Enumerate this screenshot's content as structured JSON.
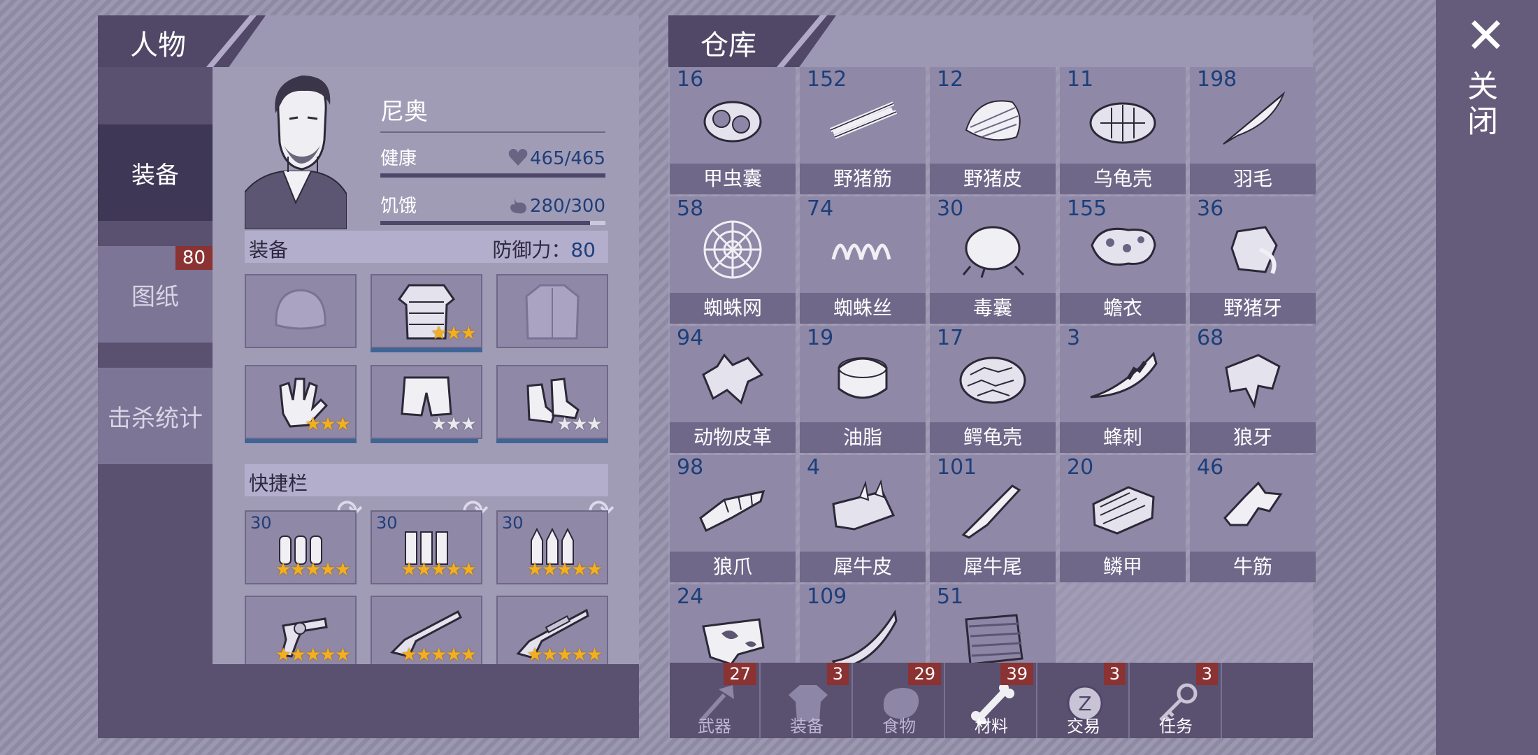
{
  "character_panel": {
    "title": "人物",
    "side_tabs": [
      {
        "label": "装备",
        "active": true
      },
      {
        "label": "图纸",
        "badge": "80"
      },
      {
        "label": "击杀统计"
      }
    ],
    "name": "尼奥",
    "health": {
      "label": "健康",
      "value": "465/465",
      "fraction": 1.0
    },
    "hunger": {
      "label": "饥饿",
      "value": "280/300",
      "fraction": 0.933
    },
    "equipment_header": {
      "label": "装备",
      "defense_label": "防御力：",
      "defense_value": "80"
    },
    "equipment_slots": [
      {
        "icon": "helmet-icon",
        "stars": 0,
        "durability": 0
      },
      {
        "icon": "armor-vest-icon",
        "stars": 3,
        "durability": 1.0
      },
      {
        "icon": "jacket-icon",
        "stars": 0,
        "durability": 0
      },
      {
        "icon": "gloves-icon",
        "stars": 3,
        "durability": 1.0
      },
      {
        "icon": "pants-icon",
        "stars": 3,
        "gold_stars": 1,
        "durability": 0.97
      },
      {
        "icon": "boots-icon",
        "stars": 3,
        "gold_stars": 0,
        "durability": 1.0
      }
    ],
    "quickbar_header": "快捷栏",
    "quickbar_ammo": [
      {
        "count": "30",
        "icon": "ammo-pistol-icon"
      },
      {
        "count": "30",
        "icon": "ammo-shotgun-icon"
      },
      {
        "count": "30",
        "icon": "ammo-rifle-icon"
      }
    ],
    "quickbar_weapons": [
      {
        "icon": "revolver-icon",
        "durability": 1.0
      },
      {
        "icon": "shotgun-icon",
        "durability": 0.93
      },
      {
        "icon": "rifle-icon",
        "durability": 1.0
      }
    ]
  },
  "inventory_panel": {
    "title": "仓库",
    "items": [
      {
        "count": "16",
        "name": "甲虫囊",
        "icon": "beetle-sac-icon"
      },
      {
        "count": "152",
        "name": "野猪筋",
        "icon": "boar-tendon-icon"
      },
      {
        "count": "12",
        "name": "野猪皮",
        "icon": "boar-hide-icon"
      },
      {
        "count": "11",
        "name": "乌龟壳",
        "icon": "turtle-shell-icon"
      },
      {
        "count": "198",
        "name": "羽毛",
        "icon": "feather-icon"
      },
      {
        "count": "58",
        "name": "蜘蛛网",
        "icon": "spider-web-icon"
      },
      {
        "count": "74",
        "name": "蜘蛛丝",
        "icon": "spider-silk-icon"
      },
      {
        "count": "30",
        "name": "毒囊",
        "icon": "poison-sac-icon"
      },
      {
        "count": "155",
        "name": "蟾衣",
        "icon": "toad-skin-icon"
      },
      {
        "count": "36",
        "name": "野猪牙",
        "icon": "boar-tusk-icon"
      },
      {
        "count": "94",
        "name": "动物皮革",
        "icon": "animal-leather-icon"
      },
      {
        "count": "19",
        "name": "油脂",
        "icon": "grease-icon"
      },
      {
        "count": "17",
        "name": "鳄龟壳",
        "icon": "snapping-turtle-shell-icon"
      },
      {
        "count": "3",
        "name": "蜂刺",
        "icon": "bee-sting-icon"
      },
      {
        "count": "68",
        "name": "狼牙",
        "icon": "wolf-fang-icon"
      },
      {
        "count": "98",
        "name": "狼爪",
        "icon": "wolf-claw-icon"
      },
      {
        "count": "4",
        "name": "犀牛皮",
        "icon": "rhino-hide-icon"
      },
      {
        "count": "101",
        "name": "犀牛尾",
        "icon": "rhino-tail-icon"
      },
      {
        "count": "20",
        "name": "鳞甲",
        "icon": "scale-armor-icon"
      },
      {
        "count": "46",
        "name": "牛筋",
        "icon": "ox-tendon-icon"
      },
      {
        "count": "24",
        "name": "",
        "icon": "cow-hide-icon"
      },
      {
        "count": "109",
        "name": "",
        "icon": "horn-icon"
      },
      {
        "count": "51",
        "name": "",
        "icon": "fur-pelt-icon"
      }
    ],
    "bottom_tabs": [
      {
        "label": "武器",
        "badge": "27",
        "icon": "axe-icon"
      },
      {
        "label": "装备",
        "badge": "3",
        "icon": "shirt-icon"
      },
      {
        "label": "食物",
        "badge": "29",
        "icon": "meat-icon"
      },
      {
        "label": "材料",
        "badge": "39",
        "icon": "bone-icon",
        "active": true
      },
      {
        "label": "交易",
        "badge": "3",
        "icon": "coin-icon"
      },
      {
        "label": "任务",
        "badge": "3",
        "icon": "key-icon"
      }
    ]
  },
  "close": {
    "label": "关闭",
    "icon": "close-icon"
  },
  "colors": {
    "accent_dark": "#514867",
    "badge_red": "#8b3232",
    "count_blue": "#1c3f7a",
    "star_gold": "#f2b01e"
  }
}
